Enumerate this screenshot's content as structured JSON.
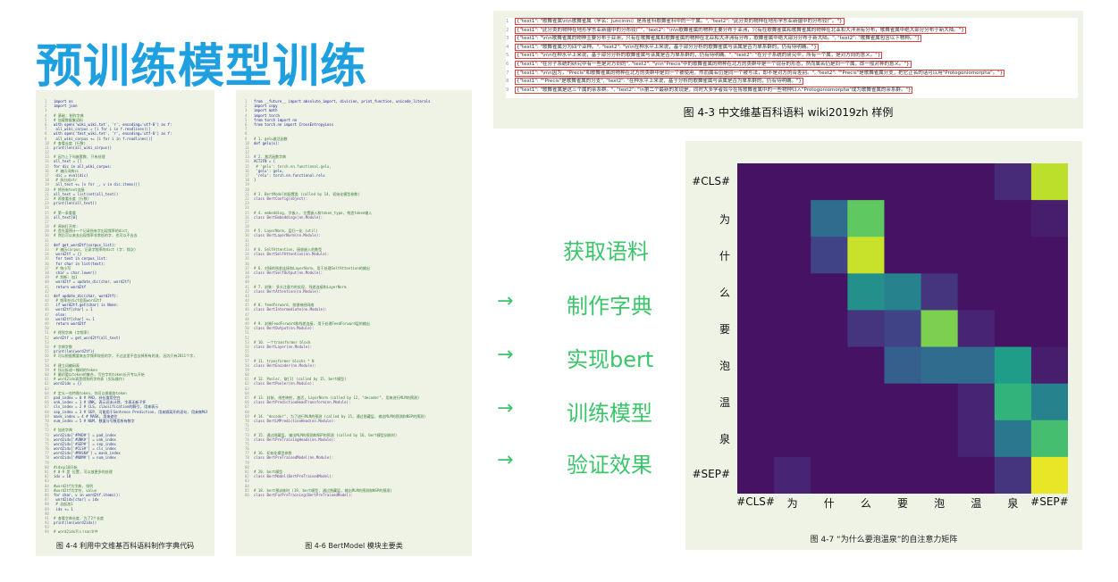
{
  "slide": {
    "title": "预训练模型训练"
  },
  "left_panel": {
    "caption": "图 4-4 利用中文维基百科语料制作字典代码",
    "lines": [
      "import os",
      "import json",
      "",
      "# 基础: 制作字典",
      "# 加载数据集语料",
      "with open('wiki_wiki.txt', 'r', encoding='utf-8') as f:",
      "    all_wiki_corpus = [i for i in f.readlines()]",
      "with open('test_wiki.txt', 'r', encoding='utf-8') as f:",
      "    all_wiki_corpus += [i for i in f.readlines()]",
      "# 查看长度 (行数)",
      "print(len(all_wiki_corpus))",
      "",
      "# 因为上下句嵌套数, 只有处理",
      "all_text = []",
      "for dic in all_wiki_corpus:",
      "    # 遍历词典sc",
      "    dic = eval(dic)",
      "    # 拆分成str",
      "    all_text += [v for _, v in dic.items()]",
      "# 将所有text连接",
      "all_text = list(set(all_text))",
      "# 再查看长度 (行数)",
      "print(len(all_text))",
      "",
      "# 第一条看看",
      "all_text[0]",
      "",
      "# 原始打开库:",
      "# 首先要预计一个记录所有字出现频率的dict,",
      "# 然后可以来去出现频率非常低的字, 也可以不去去",
      "",
      "def get_word2tf(corpus_list):",
      "    # 遍历corpus, 记录字频率的dict (字: 频次)",
      "    word2tf = {}",
      "    for text in corpus_list:",
      "        for char in list(text):",
      "            # 统小写",
      "            char = char.lower()",
      "            # 判断: 加1",
      "            word2tf = update_dic(char, word2tf)",
      "    return word2tf",
      "",
      "def update_dic(char, word2tf):",
      "    # 频率在dict里面word2tf",
      "    if word2tf.get(char) is None:",
      "        word2tf[char] = 1",
      "    else:",
      "        word2tf[char] += 1",
      "    return word2tf",
      "",
      "# 得到字典 (字频率)",
      "word2tf = get_word2tf(all_text)",
      "",
      "# 字典字数",
      "print(len(word2tf))",
      "# 可以根据需要来去字频率较低的字, 不过这里不会去掉所有的流, 因为只有2011个字,",
      "",
      "# 建立词编码表",
      "# 所以拆成一棵树的token",
      "# 最初要以token的集合, 写在字的token长开专以开始",
      "# word2idx表是得到的字符表 (实际操作)",
      "word2idx = {}",
      "",
      "# 定义一些特殊token, 你可以根据各token",
      "pad_index = 0 # PAD, 补长度用空白",
      "unk_index = 1 # UNK, 表示还未计然, 字表无新子怀",
      "cls_index = 2 # CLS, classification的解引, 用来表示",
      "sep_index = 3 # SEP, 可能用于Sentence Prediction, 用来隔离开的语句, 用来做MLM",
      "mask_index = 4 # MASK, 用来遮住",
      "num_index = 5 # NUM, 数量与号数用所有数字",
      "",
      "# 加进字典",
      "word2idx['#PAD#'] = pad_index",
      "word2idx['#UNK#'] = unk_index",
      "word2idx['#SEP#'] = sep_index",
      "word2idx['#CLS#'] = cls_index",
      "word2idx['#MASK#'] = mask_index",
      "word2idx['#NUM#'] = num_index",
      "",
      "#idx从10开始",
      "# 0-9 是 位置, 可以放更多的处理",
      "idx = 10",
      "",
      "#word2tf为字典, 排列",
      "#word2tf为字符, value",
      "for char, v in word2tf.items():",
      "    word2idx[char] = idx",
      "    # 自起加1",
      "    idx += 1",
      "",
      "# 查看字典长度, 为了2个长度",
      "print(len(word2idx))",
      "",
      "# word2idx写入json文件",
      "with open('./bert/bert_word2idx.json', 'w', encoding='utf-8') as f:",
      "    f.write(json.dumps(word2idx, ensure_ascii=False))",
      "",
      "# 字典制作完毕"
    ]
  },
  "middle_panel": {
    "caption": "图 4-6 BertModel 模块主要类",
    "lines": [
      "from __future__ import absolute_import, division, print_function, unicode_literals",
      "import copy",
      "import math",
      "import torch",
      "from torch import nn",
      "from torch.nn import CrossEntropyLoss",
      "",
      "",
      "# 1. gelu激活函数",
      "def gelu(x):",
      "",
      "",
      "# 2. 激活函数字典",
      "ACT2FN = {",
      "    # 'gelu': torch.nn.functional.gelu,",
      "    'gelu': gelu,",
      "    'relu': torch.nn.functional.relu",
      "}",
      "",
      "",
      "# 3. BertModel的配置类 (called by 14, 初始化模型参数)",
      "class BertConfig(object):",
      "",
      "",
      "# 4. embedding, 字嵌入, 位置嵌入和token_type, 构造token输入",
      "class BertEmbeddings(nn.Module):",
      "",
      "",
      "# 5. LayerNorm, 层归一化 (util)",
      "class BertLayerNorm(nn.Module):",
      "",
      "",
      "# 6. SelfAttention, 接收嵌入的数型",
      "class BertSelfAttention(nn.Module):",
      "",
      "",
      "# 6. 对接的残差连接和LayerNorm, 用于处理SelfAttention的输出",
      "class BertSelfOutput(nn.Module):",
      "",
      "",
      "# 7. 封装: 多头注意力的实现, 残差连接和LayerNorm",
      "class BertAttention(nn.Module):",
      "",
      "",
      "# 8. feedforward, 前馈神经网络",
      "class BertIntermediate(nn.Module):",
      "",
      "",
      "# 9. 封装FeedForward和残差连接, 用于处理FeedForward层的输出",
      "class BertOutput(nn.Module):",
      "",
      "",
      "# 10. 一个transformer block",
      "class BertLayer(nn.Module):",
      "",
      "",
      "# 11. transformer blocks * N",
      "class BertEncoder(nn.Module):",
      "",
      "",
      "# 12. Pooler, 取[1] (called by 15, bert模型)",
      "class BertPooler(nn.Module):",
      "",
      "",
      "# 13. 封装, 线性映射, 激活, LayerNorm (called by 12, \"decoder\", 用来进行MLM的预测)",
      "class BertPredictionHeadTransform(nn.Module):",
      "",
      "",
      "# 14. \"decoder\", 为了进行MLM的预测 (called by 15, 通过隐藏层, 输出MLM的预测和NSP的预测)",
      "class BertLMPredictionHead(nn.Module):",
      "",
      "",
      "# 15. 通过隐藏层, 输出MLM的预测和NSP的预测 (called by 16, bert模型训练时)",
      "class BertPreTrainingHeads(nn.Module):",
      "",
      "",
      "# 16. 初始化模型参数",
      "class BertPreTrainedModel(nn.Module):",
      "",
      "",
      "# 20. bert模型",
      "class BertModel(BertPreTrainedModel):",
      "",
      "",
      "# 18. bert预训练时 (19, bert模型, 通过隐藏层, 输出MLM的预测和NSP的预测)",
      "class BertForPreTraining(BertPreTrainedModel):"
    ]
  },
  "wiki_panel": {
    "caption": "图 4-3 中文维基百科语料 wiki2019zh 样例",
    "rows": [
      "{\"text1\": \"歌舞雀属\\n\\n歌舞雀属（学名：Juncinini）是燕雀科歌舞雀科中的一个属。\", \"text2\": \"此分类的物种在地形学东亚新疆中的分布较广。\"}",
      "{\"text1\": \"此分类的物种在地形学东亚新疆中的分布较广\", \"text2\": \"\\n\\n歌舞雀属的物种主要分布于亚洲，只有在歌舞雀属和歌舞雀属的物种在北亚和大洋洲有分布，歌舞雀属中绝大部分分布于新大陆。\"}",
      "{\"text1\": \"\\n\\n歌舞雀属的物种主要分布于亚洲，只有在歌舞雀属和歌舞雀属的物种在北亚和大洋洲有分布，歌舞雀属中绝大部分分布于新大陆。\", \"text2\": \"歌舞雀属包含以下物种。\"}",
      "{\"text1\": \"歌舞雀属分为四个亚种。\", \"text2\": \"\\n\\n在种水平上来说，基于部分分析的歌舞雀属与该属是否为单系群的，仍有待明确。\"}",
      "{\"text1\": \"\\n\\n在种水平上来说，基于部分分析的歌舞雀属与该属是否为单系群的，仍有待明确。\", \"text2\": \"在分子系统的研究中，所有一个属，是对方向的意义。\"}",
      "{\"text1\": \"在分子系统的研究中有一些是对方向的\", \"text2\": \"\\n\\n\"Precis\"中的歌舞雀属的物种在北方的类群中是一个现存的形态，然而属名仍是同一个属，即一般对种的意义。\"}",
      "{\"text1\": \"\\n\\n因为，\"Precis\"和歌舞雀属的物种在北方的类群中是同一个被使用，然而属名仍是同一个被写法，即不是对方的合差别。\", \"text2\": \"\"Precis\"是歌舞雀属分支，把它正名的话可以用\"Protogoniomorpha\"。\"}",
      "{\"text1\": \"\"Precis\"是歌舞雀属的分支\", \"text2\": \"在种水平上来说，基于分析的歌舞雀属与该属是否为单系群的，仍有待明确。\"}",
      "{\"text1\": \"歌舞雀属是这三个属的亲系群。\", \"text2\": \"\\n第二个最新的发现是，同时大多学者如今在将歌舞雀属中的一些物种归入\"Protogoniomorpha\"成为歌舞雀属的亲系群。\"}"
    ]
  },
  "pipeline": {
    "steps": [
      "获取语料",
      "制作字典",
      "实现bert",
      "训练模型",
      "验证效果"
    ],
    "arrow": "→",
    "color": "#3cc46a"
  },
  "chart_data": {
    "type": "heatmap",
    "title": "",
    "caption": "图 4-7 “为什么要泡温泉”的自注意力矩阵",
    "tokens": [
      "#CLS#",
      "为",
      "什",
      "么",
      "要",
      "泡",
      "温",
      "泉",
      "#SEP#"
    ],
    "colormap": "viridis",
    "matrix": [
      [
        0.05,
        0.05,
        0.05,
        0.05,
        0.05,
        0.05,
        0.05,
        0.12,
        0.9
      ],
      [
        0.05,
        0.05,
        0.35,
        0.75,
        0.05,
        0.05,
        0.05,
        0.05,
        0.08
      ],
      [
        0.05,
        0.05,
        0.2,
        0.92,
        0.05,
        0.05,
        0.05,
        0.05,
        0.05
      ],
      [
        0.05,
        0.05,
        0.05,
        0.5,
        0.45,
        0.15,
        0.05,
        0.05,
        0.05
      ],
      [
        0.05,
        0.05,
        0.05,
        0.15,
        0.2,
        0.8,
        0.1,
        0.05,
        0.05
      ],
      [
        0.05,
        0.05,
        0.05,
        0.05,
        0.3,
        0.35,
        0.35,
        0.55,
        0.08
      ],
      [
        0.05,
        0.05,
        0.05,
        0.05,
        0.05,
        0.05,
        0.1,
        0.65,
        0.45
      ],
      [
        0.05,
        0.05,
        0.05,
        0.05,
        0.05,
        0.05,
        0.1,
        0.4,
        0.7
      ],
      [
        0.05,
        0.1,
        0.05,
        0.05,
        0.05,
        0.05,
        0.05,
        0.15,
        0.97
      ]
    ]
  }
}
